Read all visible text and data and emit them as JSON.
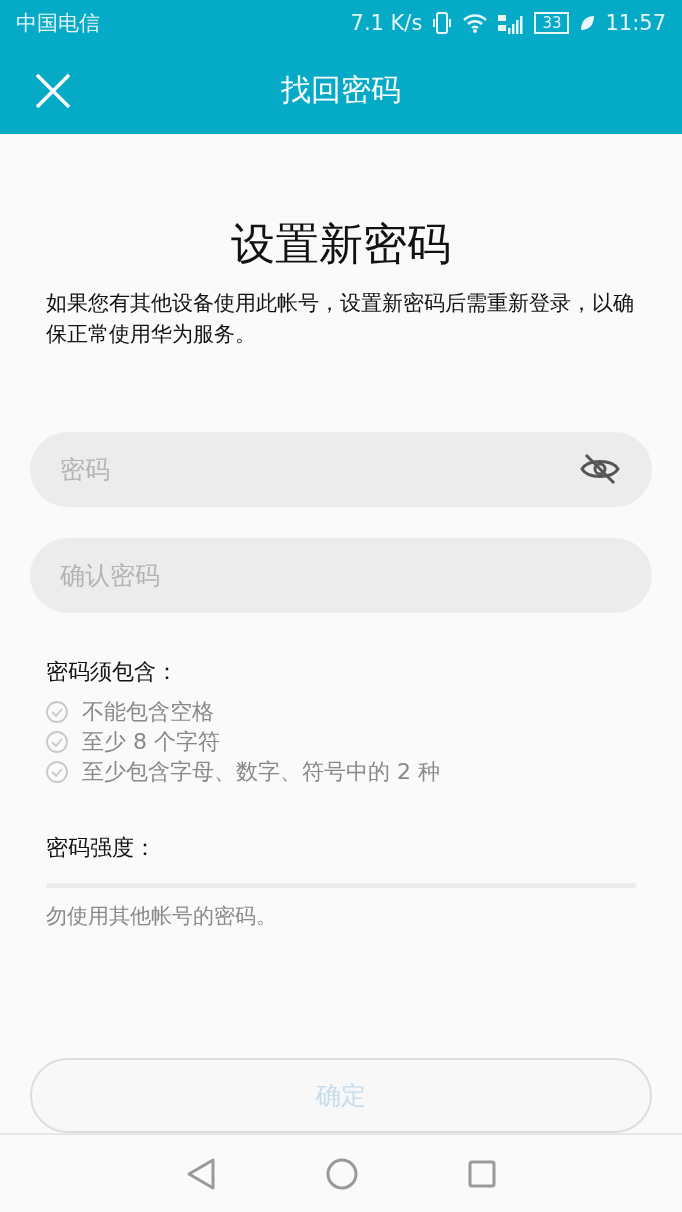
{
  "status_bar": {
    "carrier": "中国电信",
    "speed": "7.1 K/s",
    "battery": "33",
    "time": "11:57"
  },
  "header": {
    "title": "找回密码"
  },
  "heading": "设置新密码",
  "description": "如果您有其他设备使用此帐号，设置新密码后需重新登录，以确保正常使用华为服务。",
  "fields": [
    {
      "kind": "password",
      "placeholder": "密码",
      "visible": false
    },
    {
      "kind": "plain",
      "placeholder": "确认密码"
    }
  ],
  "requirements": {
    "label": "密码须包含：",
    "items": [
      {
        "text": "不能包含空格",
        "met": false
      },
      {
        "text": "至少 8 个字符",
        "met": false
      },
      {
        "text": "至少包含字母、数字、符号中的 2 种",
        "met": false
      }
    ]
  },
  "strength": {
    "label": "密码强度：",
    "level": 0
  },
  "note": "勿使用其他帐号的密码。",
  "confirm_button": {
    "label": "确定",
    "disabled": true
  }
}
